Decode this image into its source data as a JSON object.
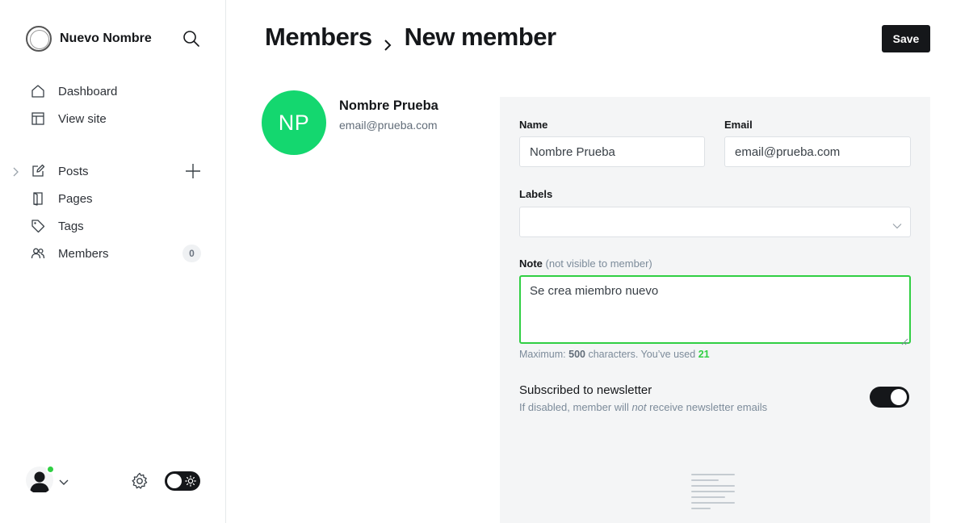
{
  "sidebar": {
    "brand": "Nuevo Nombre",
    "nav_primary": [
      {
        "label": "Dashboard",
        "icon": "home-icon"
      },
      {
        "label": "View site",
        "icon": "layout-icon"
      }
    ],
    "nav_content": [
      {
        "label": "Posts",
        "icon": "pencil-icon"
      },
      {
        "label": "Pages",
        "icon": "page-icon"
      },
      {
        "label": "Tags",
        "icon": "tag-icon"
      },
      {
        "label": "Members",
        "icon": "members-icon",
        "count": "0"
      }
    ]
  },
  "header": {
    "breadcrumb_parent": "Members",
    "breadcrumb_current": "New member",
    "save_label": "Save"
  },
  "member": {
    "initials": "NP",
    "name": "Nombre Prueba",
    "email": "email@prueba.com"
  },
  "form": {
    "name_label": "Name",
    "name_value": "Nombre Prueba",
    "email_label": "Email",
    "email_value": "email@prueba.com",
    "labels_label": "Labels",
    "note_label": "Note",
    "note_hint": "(not visible to member)",
    "note_value": "Se crea miembro nuevo",
    "counter_prefix": "Maximum:",
    "counter_max": "500",
    "counter_middle": "characters. You’ve used",
    "counter_used": "21",
    "newsletter_title": "Subscribed to newsletter",
    "newsletter_desc_before": "If disabled, member will",
    "newsletter_desc_em": "not",
    "newsletter_desc_after": "receive newsletter emails",
    "newsletter_subscribed": true
  },
  "colors": {
    "accent": "#30cf43",
    "avatar": "#14d76f",
    "dark": "#15171a",
    "panel": "#f4f5f6"
  }
}
